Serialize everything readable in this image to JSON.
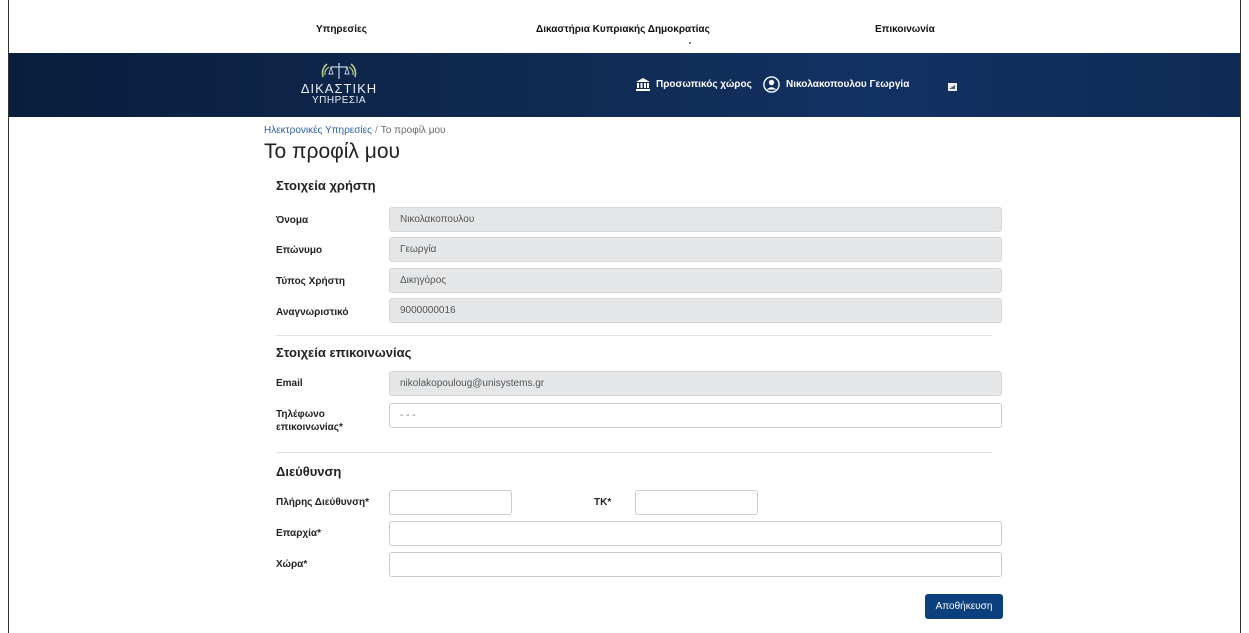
{
  "topnav": {
    "services": "Υπηρεσίες",
    "courts": "Δικαστήρια Κυπριακής Δημοκρατίας",
    "contact": "Επικοινωνία"
  },
  "header": {
    "logo_line1": "ΔΙΚΑΣΤΙΚΗ",
    "logo_line2": "ΥΠΗΡΕΣΙΑ",
    "personal_space": "Προσωπικός χώρος",
    "user_name": "Νικολακοπουλου Γεωργία"
  },
  "breadcrumb": {
    "home": "Ηλεκτρονικές Υπηρεσίες",
    "separator": "/",
    "current": "Το προφίλ μου"
  },
  "page_title": "Το προφίλ μου",
  "user_section": {
    "title": "Στοιχεία χρήστη",
    "fields": [
      {
        "label": "Όνομα",
        "value": "Νικολακοπουλου"
      },
      {
        "label": "Επώνυμο",
        "value": "Γεωργία"
      },
      {
        "label": "Τύπος Χρήστη",
        "value": "Δικηγόρος"
      },
      {
        "label": "Αναγνωριστικό",
        "value": "9000000016"
      }
    ]
  },
  "contact_section": {
    "title": "Στοιχεία επικοινωνίας",
    "email_label": "Email",
    "email_value": "nikolakopouloug@unisystems.gr",
    "phone_label_1": "Τηλέφωνο",
    "phone_label_2": "επικοινωνίας*",
    "phone_placeholder": "- - -"
  },
  "address_section": {
    "title": "Διεύθυνση",
    "full_address_label": "Πλήρης Διεύθυνση*",
    "postal_label": "ΤΚ*",
    "province_label": "Επαρχία*",
    "country_label": "Χώρα*"
  },
  "save_button": "Αποθήκευση",
  "colors": {
    "header_dark": "#0a1e3c",
    "accent_button": "#0c3f7e",
    "link": "#2b5ea8",
    "readonly_bg": "#e4e6e8"
  },
  "icons": {
    "personal_space": "bank-icon",
    "user": "user-circle-icon",
    "header_right": "calendar-icon"
  }
}
